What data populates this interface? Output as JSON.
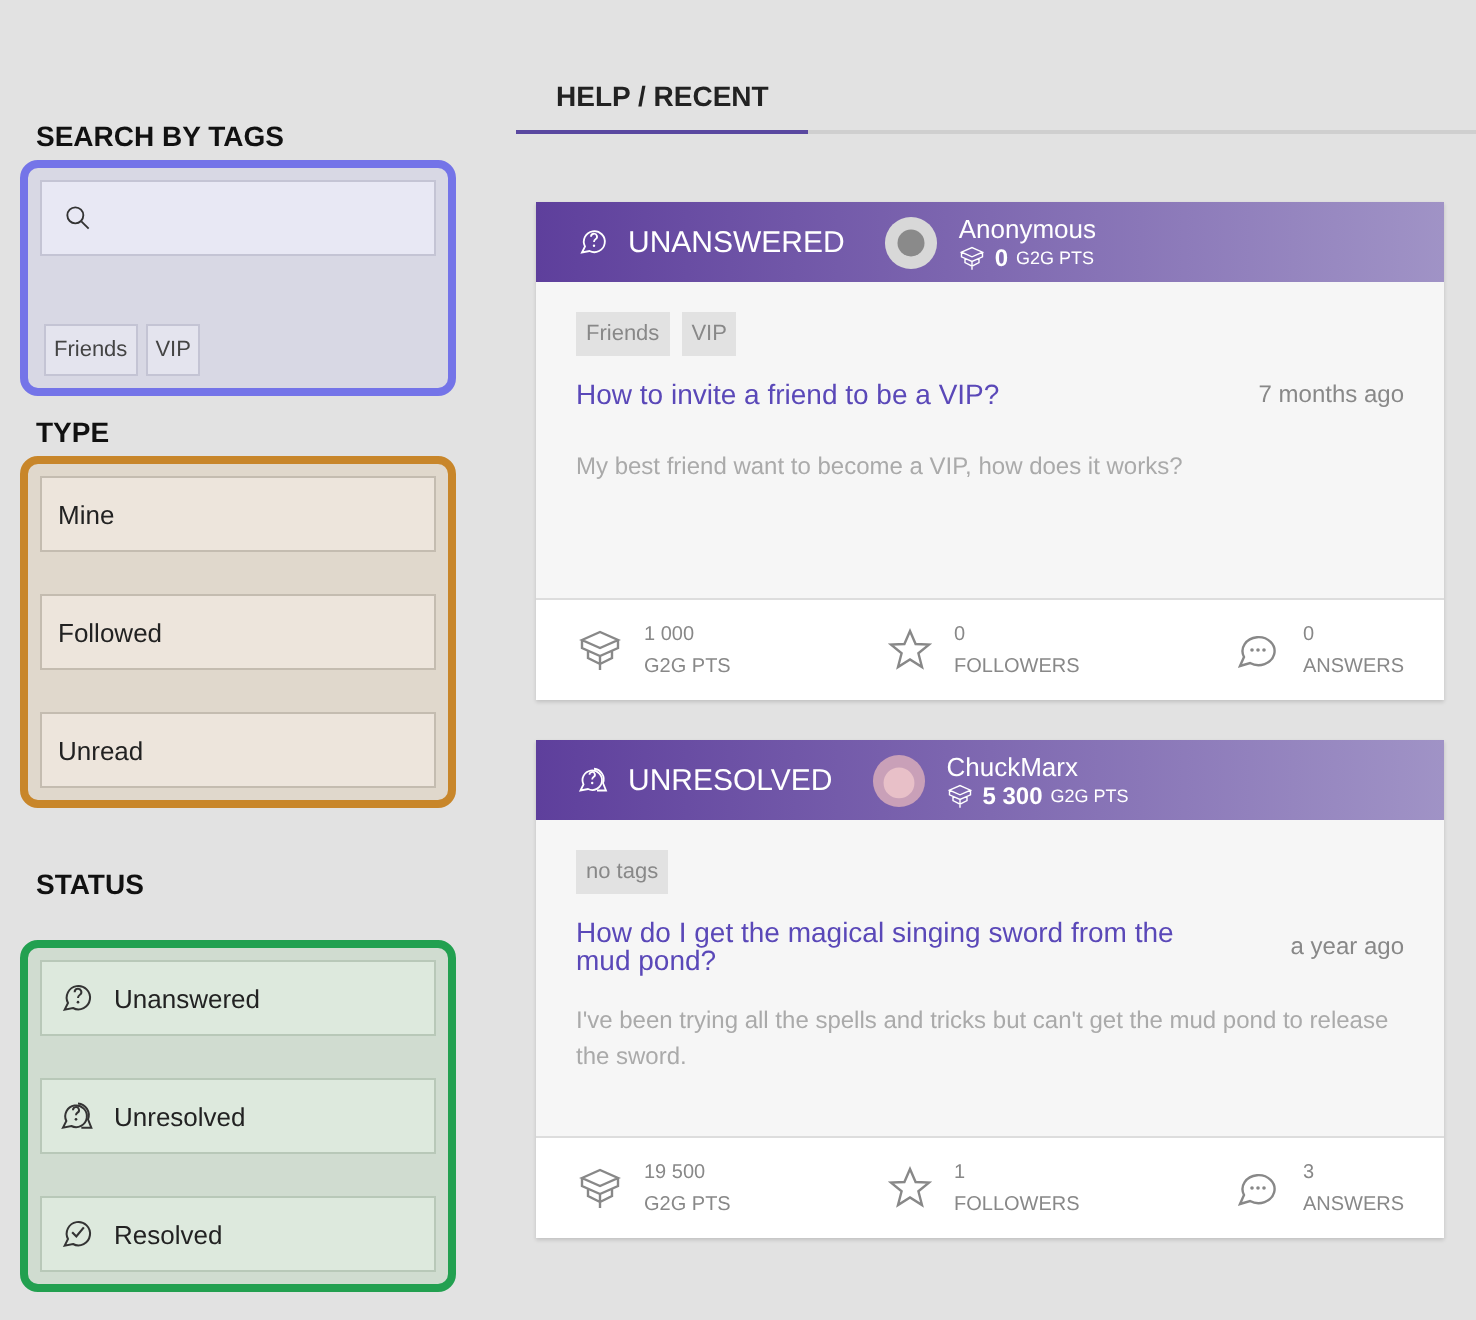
{
  "sidebar": {
    "search": {
      "title": "SEARCH BY TAGS",
      "color": "#7474e8",
      "tags": [
        "Friends",
        "VIP"
      ]
    },
    "type": {
      "title": "TYPE",
      "color": "#c8862a",
      "items": [
        {
          "label": "Mine"
        },
        {
          "label": "Followed"
        },
        {
          "label": "Unread"
        }
      ]
    },
    "status": {
      "title": "STATUS",
      "color": "#22a050",
      "items": [
        {
          "label": "Unanswered",
          "kind": "unanswered"
        },
        {
          "label": "Unresolved",
          "kind": "unresolved"
        },
        {
          "label": "Resolved",
          "kind": "resolved"
        }
      ]
    }
  },
  "tabs": [
    {
      "label": "HELP / RECENT",
      "selected": true
    }
  ],
  "questions": [
    {
      "status": "UNANSWERED",
      "kind": "unanswered",
      "author": "Anonymous",
      "author_points": "0",
      "points_unit": "G2G PTS",
      "tags": [
        "Friends",
        "VIP"
      ],
      "title": "How to invite a friend to be a VIP?",
      "time": "7 months ago",
      "body": "My best friend want to become a VIP, how does it works?",
      "stats": [
        {
          "kind": "points",
          "value": "1 000",
          "label": "G2G PTS"
        },
        {
          "kind": "followers",
          "value": "0",
          "label": "FOLLOWERS"
        },
        {
          "kind": "answers",
          "value": "0",
          "label": "ANSWERS"
        }
      ]
    },
    {
      "status": "UNRESOLVED",
      "kind": "unresolved",
      "author": "ChuckMarx",
      "author_points": "5 300",
      "points_unit": "G2G PTS",
      "tags": [
        "no tags"
      ],
      "title": "How do I get the magical singing sword from the mud pond?",
      "time": "a year ago",
      "body": "I've been trying all the spells and tricks but can't get the mud pond to release the sword.",
      "stats": [
        {
          "kind": "points",
          "value": "19 500",
          "label": "G2G PTS"
        },
        {
          "kind": "followers",
          "value": "1",
          "label": "FOLLOWERS"
        },
        {
          "kind": "answers",
          "value": "3",
          "label": "ANSWERS"
        }
      ]
    }
  ]
}
